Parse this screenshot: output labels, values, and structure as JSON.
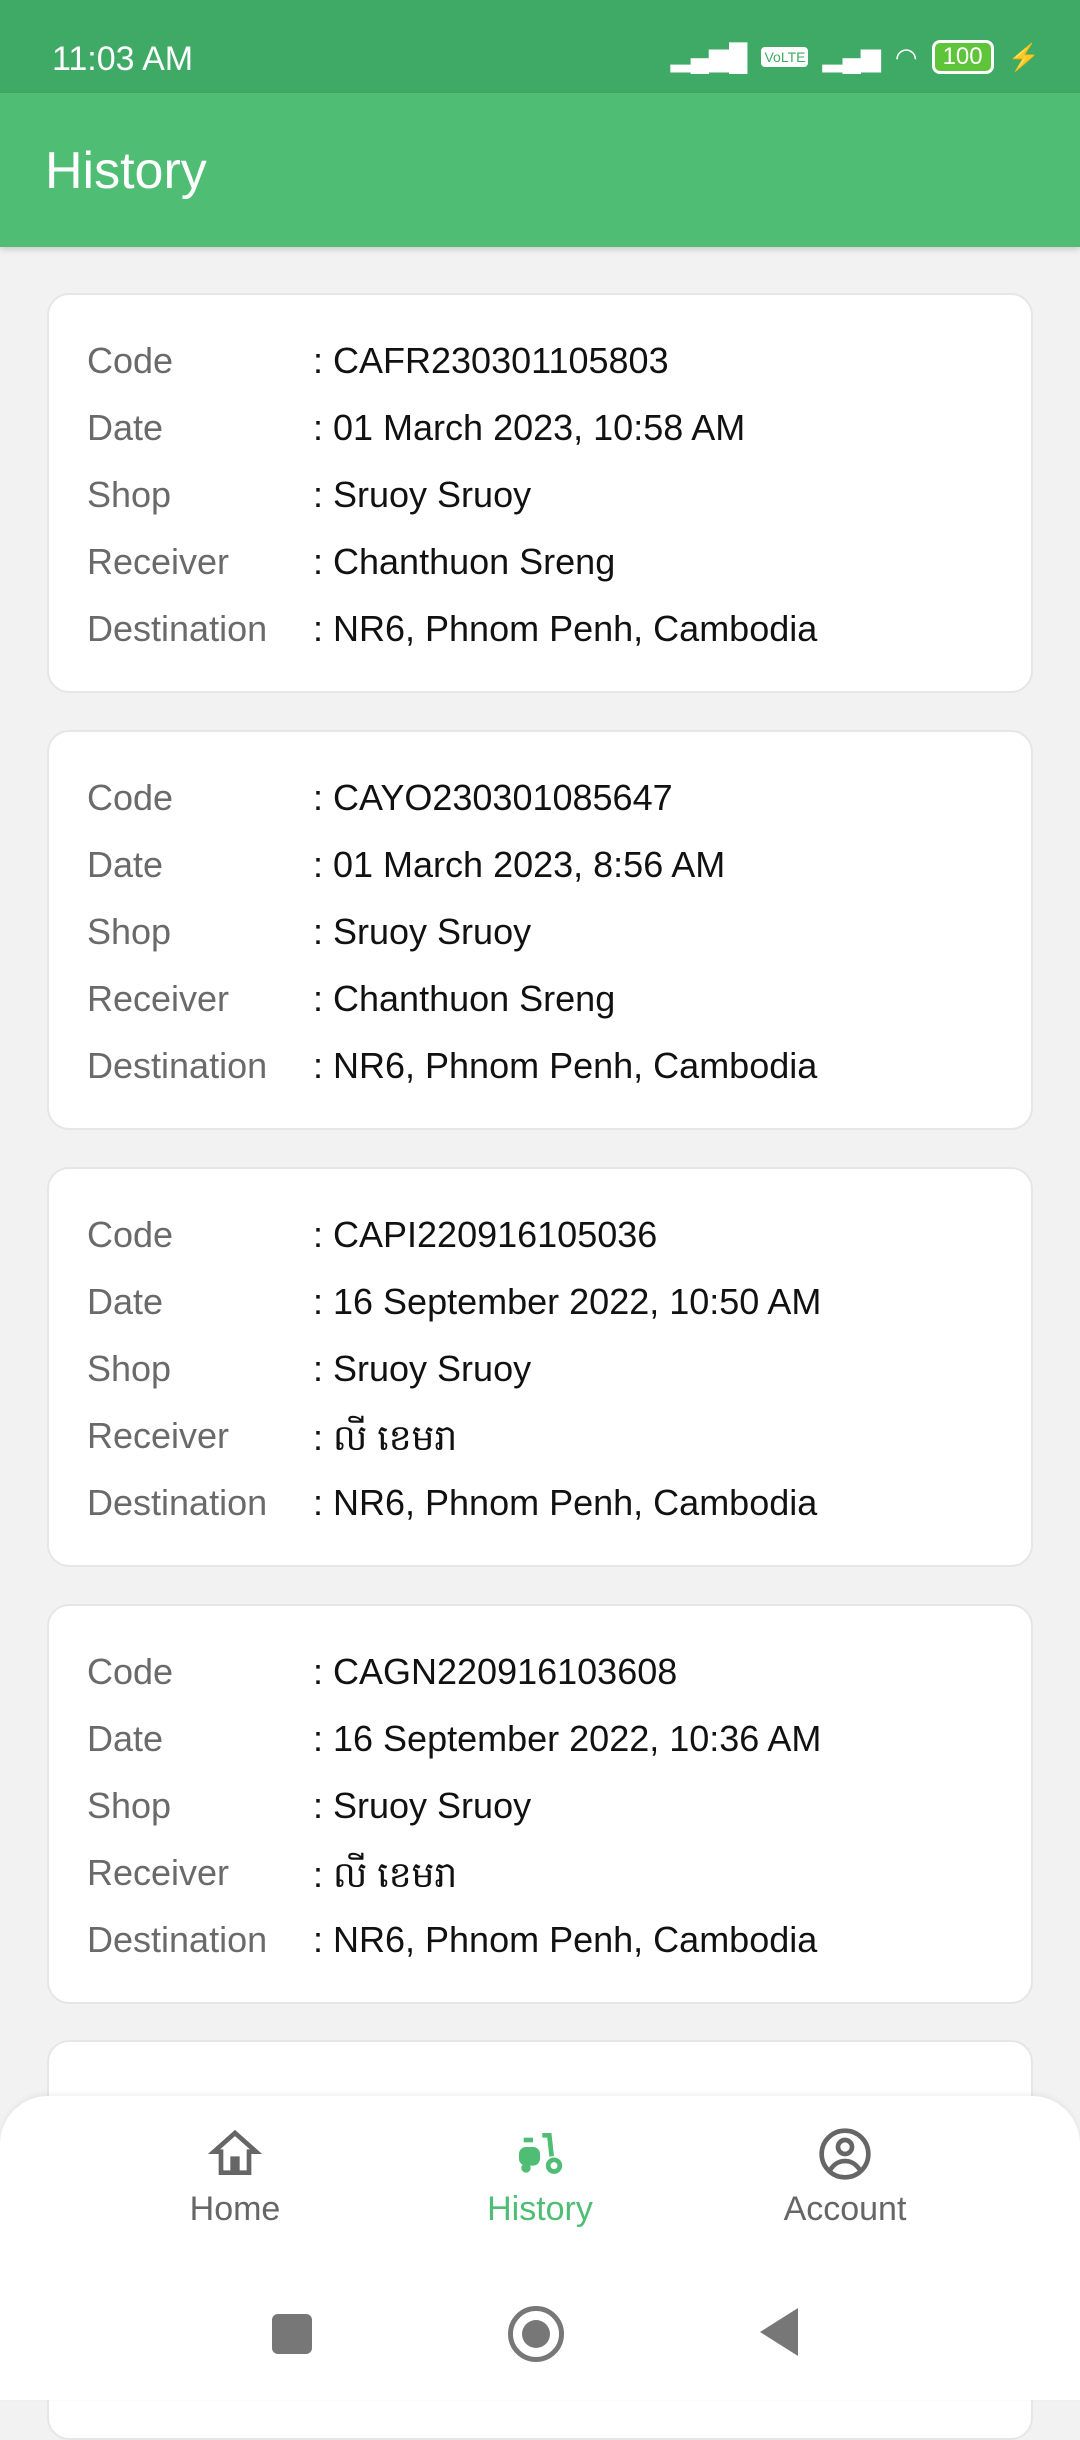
{
  "status_bar": {
    "time": "11:03 AM",
    "battery": "100",
    "volte": "VoLTE"
  },
  "header": {
    "title": "History"
  },
  "labels": {
    "code": "Code",
    "date": "Date",
    "shop": "Shop",
    "receiver": "Receiver",
    "destination": "Destination"
  },
  "orders": [
    {
      "code": ": CAFR230301105803",
      "date": ": 01 March 2023, 10:58 AM",
      "shop": ": Sruoy Sruoy",
      "receiver": ": Chanthuon Sreng",
      "destination": ": NR6, Phnom Penh, Cambodia"
    },
    {
      "code": ": CAYO230301085647",
      "date": ": 01 March 2023, 8:56 AM",
      "shop": ": Sruoy Sruoy",
      "receiver": ": Chanthuon Sreng",
      "destination": ": NR6, Phnom Penh, Cambodia"
    },
    {
      "code": ": CAPI220916105036",
      "date": ": 16 September 2022, 10:50 AM",
      "shop": ": Sruoy Sruoy",
      "receiver": ": លី ខេមរា",
      "destination": ": NR6, Phnom Penh, Cambodia"
    },
    {
      "code": ": CAGN220916103608",
      "date": ": 16 September 2022, 10:36 AM",
      "shop": ": Sruoy Sruoy",
      "receiver": ": លី ខេមរា",
      "destination": ": NR6, Phnom Penh, Cambodia"
    }
  ],
  "bottom_nav": {
    "items": [
      {
        "label": "Home",
        "icon": "home-icon"
      },
      {
        "label": "History",
        "icon": "scooter-icon",
        "active": true
      },
      {
        "label": "Account",
        "icon": "account-icon"
      }
    ]
  },
  "colors": {
    "primary": "#4fbd74",
    "status_bar": "#3faa66"
  }
}
